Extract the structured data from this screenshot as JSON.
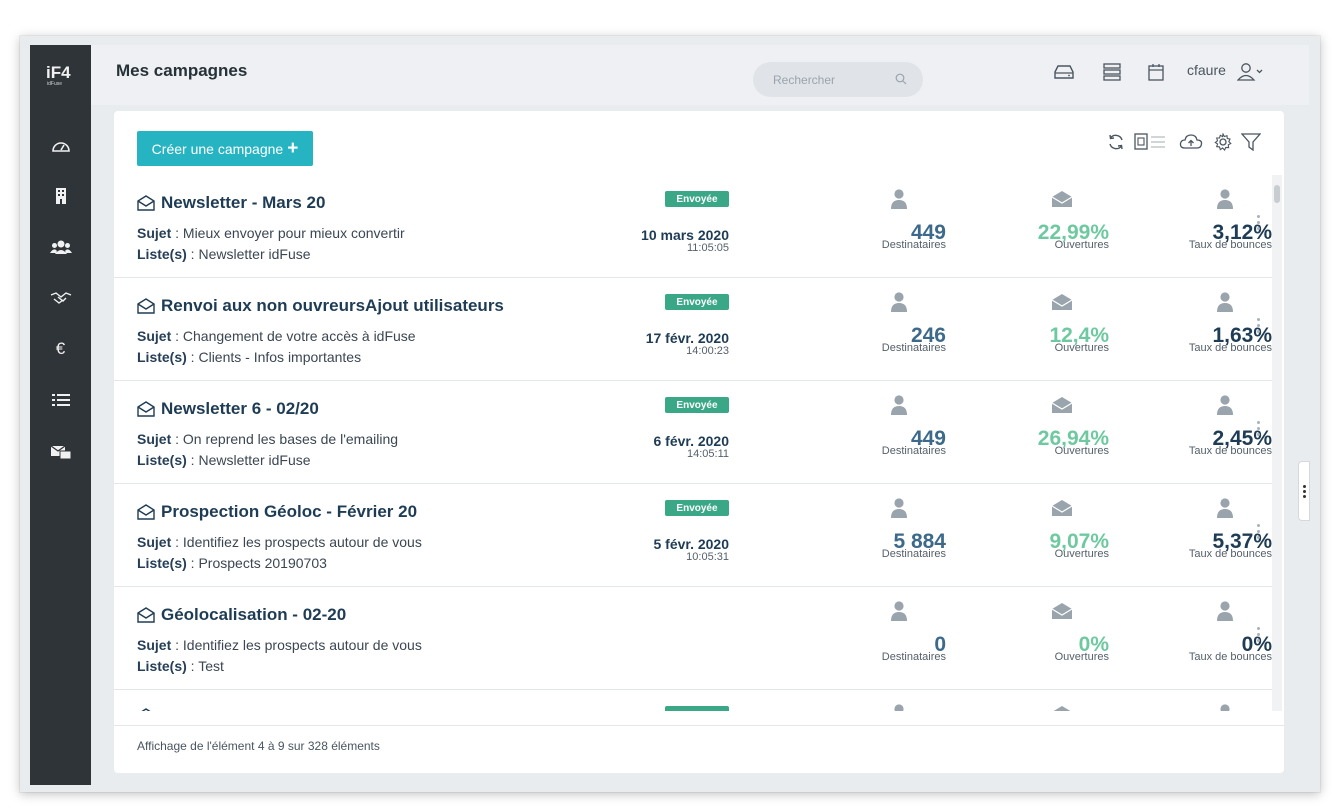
{
  "app": {
    "logo_text": "iF4",
    "logo_subtext": "idFuse",
    "page_title": "Mes campagnes"
  },
  "sidebar": {
    "items": [
      {
        "name": "dashboard",
        "icon": "gauge-icon"
      },
      {
        "name": "companies",
        "icon": "building-icon"
      },
      {
        "name": "contacts",
        "icon": "users-icon"
      },
      {
        "name": "deals",
        "icon": "handshake-icon"
      },
      {
        "name": "finance",
        "icon": "euro-icon"
      },
      {
        "name": "lists",
        "icon": "list-icon"
      },
      {
        "name": "campaigns",
        "icon": "mail-stack-icon"
      }
    ]
  },
  "header": {
    "search_placeholder": "Rechercher",
    "username": "cfaure",
    "icons": [
      "inbox-icon",
      "server-icon",
      "calendar-icon",
      "user-icon"
    ]
  },
  "toolbar": {
    "create_label": "Créer une campagne",
    "create_plus": "+",
    "tools": [
      "refresh-icon",
      "export-icon",
      "cloud-upload-icon",
      "settings-icon",
      "filter-icon"
    ]
  },
  "labels": {
    "subject": "Sujet",
    "lists": "Liste(s)",
    "recipients": "Destinataires",
    "opens": "Ouvertures",
    "bounces": "Taux de bounces"
  },
  "campaigns": [
    {
      "title": "Newsletter - Mars 20",
      "subject": "Mieux envoyer pour mieux convertir",
      "lists": "Newsletter idFuse",
      "status": "Envoyée",
      "date": "10 mars 2020",
      "time": "11:05:05",
      "recipients": "449",
      "opens": "22,99%",
      "bounces": "3,12%"
    },
    {
      "title": "Renvoi aux non ouvreursAjout utilisateurs",
      "subject": "Changement de votre accès à idFuse",
      "lists": "Clients - Infos importantes",
      "status": "Envoyée",
      "date": "17 févr. 2020",
      "time": "14:00:23",
      "recipients": "246",
      "opens": "12,4%",
      "bounces": "1,63%"
    },
    {
      "title": "Newsletter 6 - 02/20",
      "subject": "On reprend les bases de l'emailing",
      "lists": "Newsletter idFuse",
      "status": "Envoyée",
      "date": "6 févr. 2020",
      "time": "14:05:11",
      "recipients": "449",
      "opens": "26,94%",
      "bounces": "2,45%"
    },
    {
      "title": "Prospection Géoloc - Février 20",
      "subject": "Identifiez les prospects autour de vous",
      "lists": "Prospects 20190703",
      "status": "Envoyée",
      "date": "5 févr. 2020",
      "time": "10:05:31",
      "recipients": "5 884",
      "opens": "9,07%",
      "bounces": "5,37%"
    },
    {
      "title": "Géolocalisation - 02-20",
      "subject": "Identifiez les prospects autour de vous",
      "lists": "Test",
      "status": "",
      "date": "",
      "time": "",
      "recipients": "0",
      "opens": "0%",
      "bounces": "0%"
    }
  ],
  "footer": {
    "pagination_text": "Affichage de l'élément 4 à 9 sur 328 éléments"
  },
  "colors": {
    "sidebar": "#2f3438",
    "accent": "#27b4c2",
    "badge": "#3aa886",
    "opens": "#6ec9a0",
    "recipients": "#3d6a8a",
    "title": "#1f3c55"
  }
}
